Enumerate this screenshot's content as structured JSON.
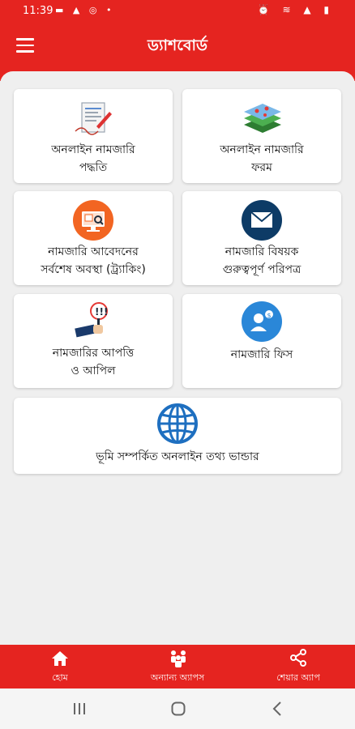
{
  "status": {
    "time": "11:39"
  },
  "appbar": {
    "title": "ড্যাশবোর্ড"
  },
  "cards": [
    {
      "label_line1": "অনলাইন নামজারি",
      "label_line2": "পদ্ধতি",
      "icon": "application-form-icon"
    },
    {
      "label_line1": "অনলাইন নামজারি",
      "label_line2": "ফরম",
      "icon": "layered-map-icon"
    },
    {
      "label_line1": "নামজারি আবেদনের",
      "label_line2": "সর্বশেষ অবস্থা (ট্র্যাকিং)",
      "icon": "monitor-search-icon"
    },
    {
      "label_line1": "নামজারি বিষয়ক",
      "label_line2": "গুরুত্বপূর্ণ পরিপত্র",
      "icon": "envelope-icon"
    },
    {
      "label_line1": "নামজারির আপত্তি",
      "label_line2": "ও আপিল",
      "icon": "objection-hand-icon"
    },
    {
      "label_line1": "নামজারি ফিস",
      "label_line2": "",
      "icon": "fee-person-icon"
    },
    {
      "label_line1": "ভূমি সম্পর্কিত অনলাইন তথ্য ভান্ডার",
      "label_line2": "",
      "icon": "globe-icon"
    }
  ],
  "bottom_nav": [
    {
      "label": "হোম",
      "icon": "home-icon"
    },
    {
      "label": "অন্যান্য অ্যাপস",
      "icon": "people-icon"
    },
    {
      "label": "শেয়ার অ্যাপ",
      "icon": "share-icon"
    }
  ],
  "colors": {
    "primary": "#e52420",
    "background": "#efefef",
    "card": "#ffffff",
    "icon_blue": "#1565c0",
    "icon_orange": "#f26522",
    "icon_navy": "#0d3b66"
  }
}
